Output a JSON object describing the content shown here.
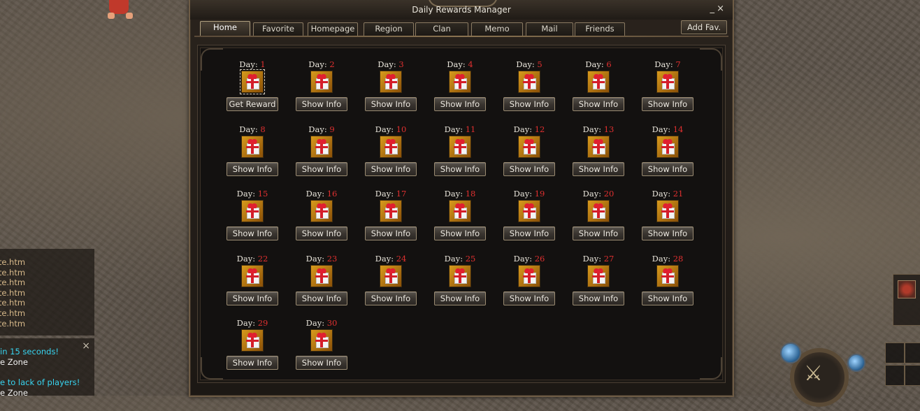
{
  "window": {
    "title": "Daily Rewards Manager",
    "minimize_glyph": "_",
    "close_glyph": "×"
  },
  "tabs": [
    {
      "label": "Home",
      "active": true
    },
    {
      "label": "Favorite",
      "active": false
    },
    {
      "label": "Homepage",
      "active": false
    },
    {
      "label": "Region",
      "active": false
    },
    {
      "label": "Clan",
      "active": false
    },
    {
      "label": "Memo",
      "active": false
    },
    {
      "label": "Mail",
      "active": false
    },
    {
      "label": "Friends",
      "active": false
    }
  ],
  "add_fav_label": "Add Fav.",
  "day_prefix": "Day: ",
  "days": [
    {
      "day": "1",
      "button": "Get Reward",
      "claimable": true
    },
    {
      "day": "2",
      "button": "Show Info"
    },
    {
      "day": "3",
      "button": "Show Info"
    },
    {
      "day": "4",
      "button": "Show Info"
    },
    {
      "day": "5",
      "button": "Show Info"
    },
    {
      "day": "6",
      "button": "Show Info"
    },
    {
      "day": "7",
      "button": "Show Info"
    },
    {
      "day": "8",
      "button": "Show Info"
    },
    {
      "day": "9",
      "button": "Show Info"
    },
    {
      "day": "10",
      "button": "Show Info"
    },
    {
      "day": "11",
      "button": "Show Info"
    },
    {
      "day": "12",
      "button": "Show Info"
    },
    {
      "day": "13",
      "button": "Show Info"
    },
    {
      "day": "14",
      "button": "Show Info"
    },
    {
      "day": "15",
      "button": "Show Info"
    },
    {
      "day": "16",
      "button": "Show Info"
    },
    {
      "day": "17",
      "button": "Show Info"
    },
    {
      "day": "18",
      "button": "Show Info"
    },
    {
      "day": "19",
      "button": "Show Info"
    },
    {
      "day": "20",
      "button": "Show Info"
    },
    {
      "day": "21",
      "button": "Show Info"
    },
    {
      "day": "22",
      "button": "Show Info"
    },
    {
      "day": "23",
      "button": "Show Info"
    },
    {
      "day": "24",
      "button": "Show Info"
    },
    {
      "day": "25",
      "button": "Show Info"
    },
    {
      "day": "26",
      "button": "Show Info"
    },
    {
      "day": "27",
      "button": "Show Info"
    },
    {
      "day": "28",
      "button": "Show Info"
    },
    {
      "day": "29",
      "button": "Show Info"
    },
    {
      "day": "30",
      "button": "Show Info"
    }
  ],
  "file_log": [
    "emplate.htm",
    "emplate.htm",
    "emplate.htm",
    "emplate.htm",
    "emplate.htm",
    "emplate.htm",
    "emplate.htm"
  ],
  "chat": {
    "lines": [
      {
        "text": "in 15 seconds!",
        "color": "cyan"
      },
      {
        "text": "e Zone",
        "color": "white"
      },
      {
        "text": "e to lack of players!",
        "color": "cyan"
      },
      {
        "text": "e Zone",
        "color": "white"
      }
    ],
    "close_glyph": "×"
  },
  "colors": {
    "day_number": "#e03030",
    "chat_system": "#38d4f0",
    "log_text": "#d7b98a"
  }
}
